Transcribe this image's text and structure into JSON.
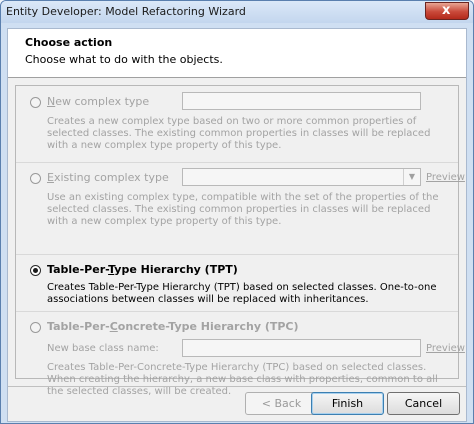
{
  "window": {
    "title": "Entity Developer: Model Refactoring Wizard",
    "close_glyph": "x"
  },
  "header": {
    "title": "Choose action",
    "subtitle": "Choose what to do with the objects."
  },
  "options": [
    {
      "label": "New complex type",
      "accelerator": "N",
      "label_rest": "ew complex type",
      "selected": false,
      "enabled": false,
      "description": "Creates a new complex type based on two or more common properties of selected classes. The existing common properties in classes will be replaced with a new complex type property of this type."
    },
    {
      "label": "Existing complex type",
      "accelerator": "E",
      "label_rest": "xisting complex type",
      "selected": false,
      "enabled": false,
      "preview_label": "Preview",
      "description": "Use an existing complex type, compatible with the set of the properties of the selected classes. The existing common properties in classes will be replaced with a new complex type property of this type."
    },
    {
      "label": "Table-Per-Type Hierarchy (TPT)",
      "label_pre": "Table-Per-",
      "accelerator": "T",
      "label_rest": "ype Hierarchy (TPT)",
      "selected": true,
      "enabled": true,
      "description": "Creates Table-Per-Type Hierarchy (TPT) based on selected classes. One-to-one associations between classes will be replaced with inheritances."
    },
    {
      "label": "Table-Per-Concrete-Type Hierarchy (TPC)",
      "label_pre": "Table-Per-",
      "accelerator": "C",
      "label_rest": "oncrete-Type Hierarchy (TPC)",
      "selected": false,
      "enabled": false,
      "field_label": "New base class name:",
      "preview_label": "Preview",
      "description": "Creates Table-Per-Concrete-Type Hierarchy (TPC) based on selected classes. When creating the hierarchy, a new base class with properties, common to all the selected classes, will be created."
    }
  ],
  "buttons": {
    "back": "< Back",
    "finish": "Finish",
    "cancel": "Cancel"
  }
}
